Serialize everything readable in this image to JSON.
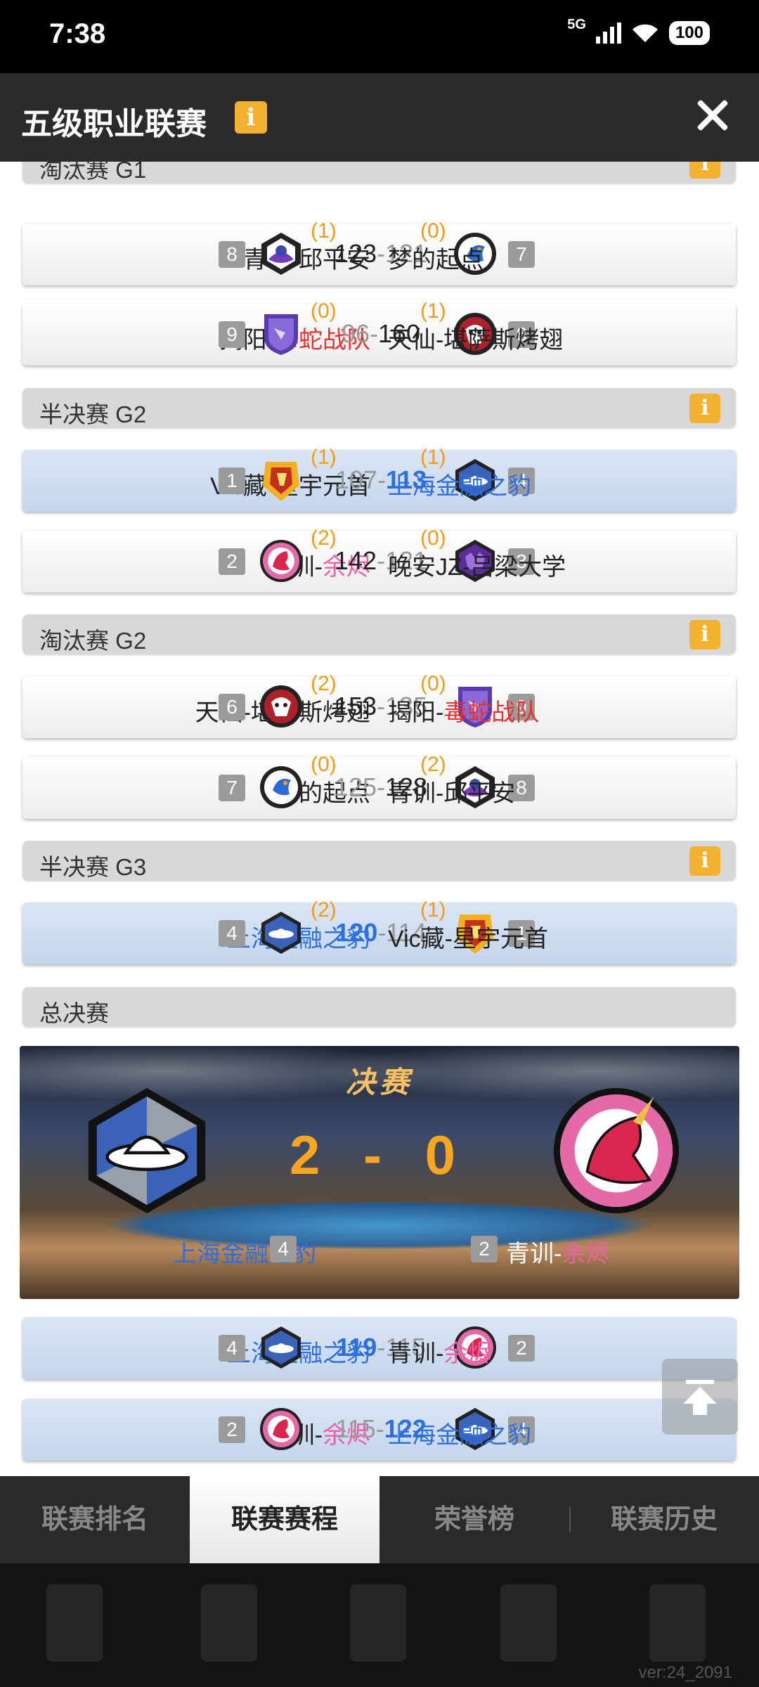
{
  "status": {
    "time": "7:38",
    "network": "5G",
    "battery": "100"
  },
  "header": {
    "title": "五级职业联赛",
    "info_icon": "info-icon"
  },
  "rounds": [
    {
      "label": "淘汰赛 G1"
    },
    {
      "label": "半决赛 G2"
    },
    {
      "label": "淘汰赛 G2"
    },
    {
      "label": "半决赛 G3"
    },
    {
      "label": "总决赛"
    }
  ],
  "matches": [
    {
      "left_prefix": "青训-邱平安",
      "left_suffix": "",
      "left_seed": "8",
      "left_wins": "(1)",
      "score_left": "123",
      "score_dash": "-",
      "score_right": "121",
      "right_wins": "(0)",
      "right_seed": "7",
      "right_prefix": "梦的起点",
      "right_suffix": ""
    },
    {
      "left_prefix": "揭阳-",
      "left_suffix": "毒蛇战队",
      "left_seed": "9",
      "left_wins": "(0)",
      "score_left": "96",
      "score_dash": "-",
      "score_right": "160",
      "right_wins": "(1)",
      "right_seed": "6",
      "right_prefix": "天仙-堪萨斯烤翅",
      "right_suffix": ""
    },
    {
      "left_prefix": "Vic藏-星宇元首",
      "left_suffix": "",
      "left_seed": "1",
      "left_wins": "(1)",
      "score_left": "107",
      "score_dash": "-",
      "score_right": "113",
      "right_wins": "(1)",
      "right_seed": "4",
      "right_prefix": "上海金融之豹",
      "right_suffix": ""
    },
    {
      "left_prefix": "青训-",
      "left_suffix": "余烬",
      "left_seed": "2",
      "left_wins": "(2)",
      "score_left": "142",
      "score_dash": "-",
      "score_right": "121",
      "right_wins": "(0)",
      "right_seed": "3",
      "right_prefix": "晚安JZ-吕梁大学",
      "right_suffix": ""
    },
    {
      "left_prefix": "天仙-堪萨斯烤翅",
      "left_suffix": "",
      "left_seed": "6",
      "left_wins": "(2)",
      "score_left": "153",
      "score_dash": "-",
      "score_right": "135",
      "right_wins": "(0)",
      "right_seed": "9",
      "right_prefix": "揭阳-",
      "right_suffix": "毒蛇战队"
    },
    {
      "left_prefix": "梦的起点",
      "left_suffix": "",
      "left_seed": "7",
      "left_wins": "(0)",
      "score_left": "125",
      "score_dash": "-",
      "score_right": "128",
      "right_wins": "(2)",
      "right_seed": "8",
      "right_prefix": "青训-邱平安",
      "right_suffix": ""
    },
    {
      "left_prefix": "上海金融之豹",
      "left_suffix": "",
      "left_seed": "4",
      "left_wins": "(2)",
      "score_left": "120",
      "score_dash": "-",
      "score_right": "114",
      "right_wins": "(1)",
      "right_seed": "1",
      "right_prefix": "Vic藏-星宇元首",
      "right_suffix": ""
    }
  ],
  "final": {
    "title": "决赛",
    "score": "2 - 0",
    "left_team": "上海金融之豹",
    "left_seed": "4",
    "right_prefix": "青训-",
    "right_suffix": "余烬",
    "right_seed": "2"
  },
  "final_games": [
    {
      "left_prefix": "上海金融之豹",
      "left_suffix": "",
      "left_seed": "4",
      "score_left": "119",
      "score_dash": "-",
      "score_right": "115",
      "right_seed": "2",
      "right_prefix": "青训-",
      "right_suffix": "余烬"
    },
    {
      "left_prefix": "青训-",
      "left_suffix": "余烬",
      "left_seed": "2",
      "score_left": "115",
      "score_dash": "-",
      "score_right": "122",
      "right_seed": "4",
      "right_prefix": "上海金融之豹",
      "right_suffix": ""
    }
  ],
  "tabs": [
    {
      "label": "联赛排名"
    },
    {
      "label": "联赛赛程"
    },
    {
      "label": "荣誉榜"
    },
    {
      "label": "联赛历史"
    }
  ],
  "version": "ver:24_2091",
  "colors": {
    "accent": "#f2b230",
    "win_blue": "#2d6fe0",
    "wins_orange": "#f39a1a",
    "team_red": "#e8322e",
    "team_pink": "#ec5fa8"
  }
}
